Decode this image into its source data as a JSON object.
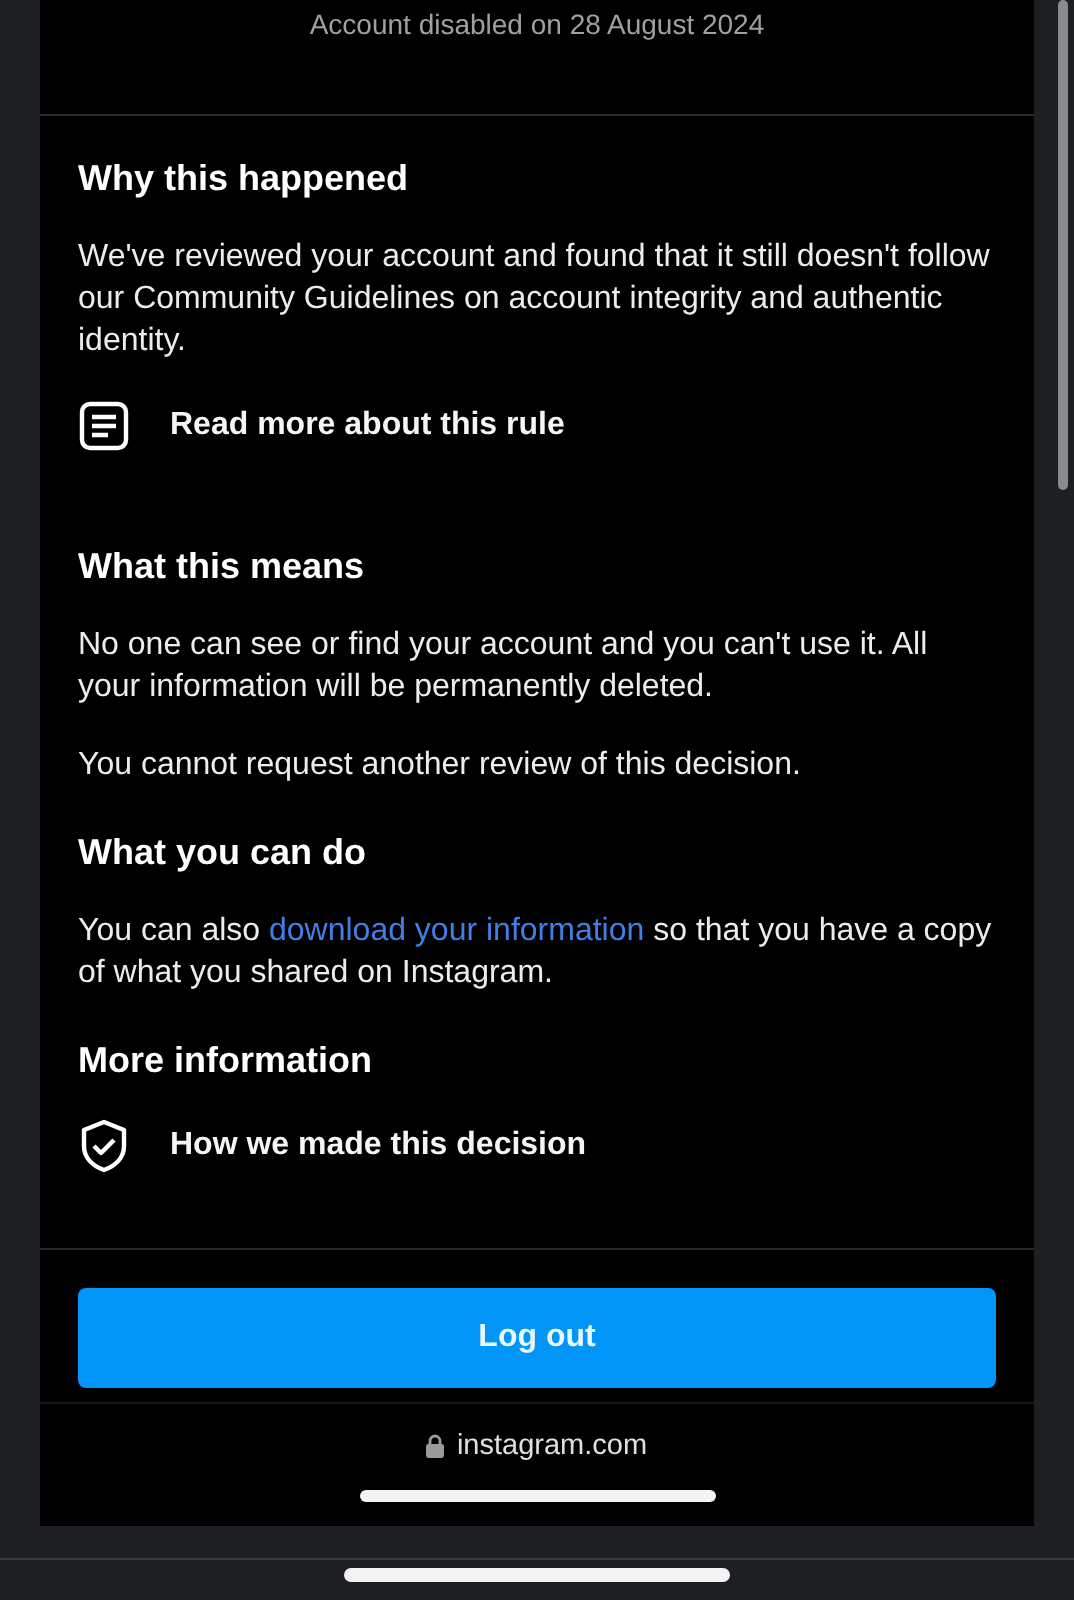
{
  "status": "Account disabled on 28 August 2024",
  "sections": [
    {
      "heading": "Why this happened",
      "paragraphs": [
        {
          "text": "We've reviewed your account and found that it still doesn't follow our Community Guidelines on account integrity and authentic identity."
        }
      ],
      "links": [
        {
          "kind": "document",
          "label": "Read more about this rule"
        }
      ]
    },
    {
      "heading": "What this means",
      "paragraphs": [
        {
          "text": "No one can see or find your account and you can't use it. All your information will be permanently deleted."
        },
        {
          "text": "You cannot request another review of this decision."
        }
      ]
    },
    {
      "heading": "What you can do",
      "paragraphs": [
        {
          "text": "You can also ",
          "link": "download your information",
          "after": " so that you have a copy of what you shared on Instagram."
        }
      ]
    },
    {
      "heading": "More information",
      "links": [
        {
          "kind": "shield",
          "label": "How we made this decision"
        }
      ]
    }
  ],
  "button": "Log out",
  "address_bar": {
    "url": "instagram.com",
    "secure": true
  }
}
